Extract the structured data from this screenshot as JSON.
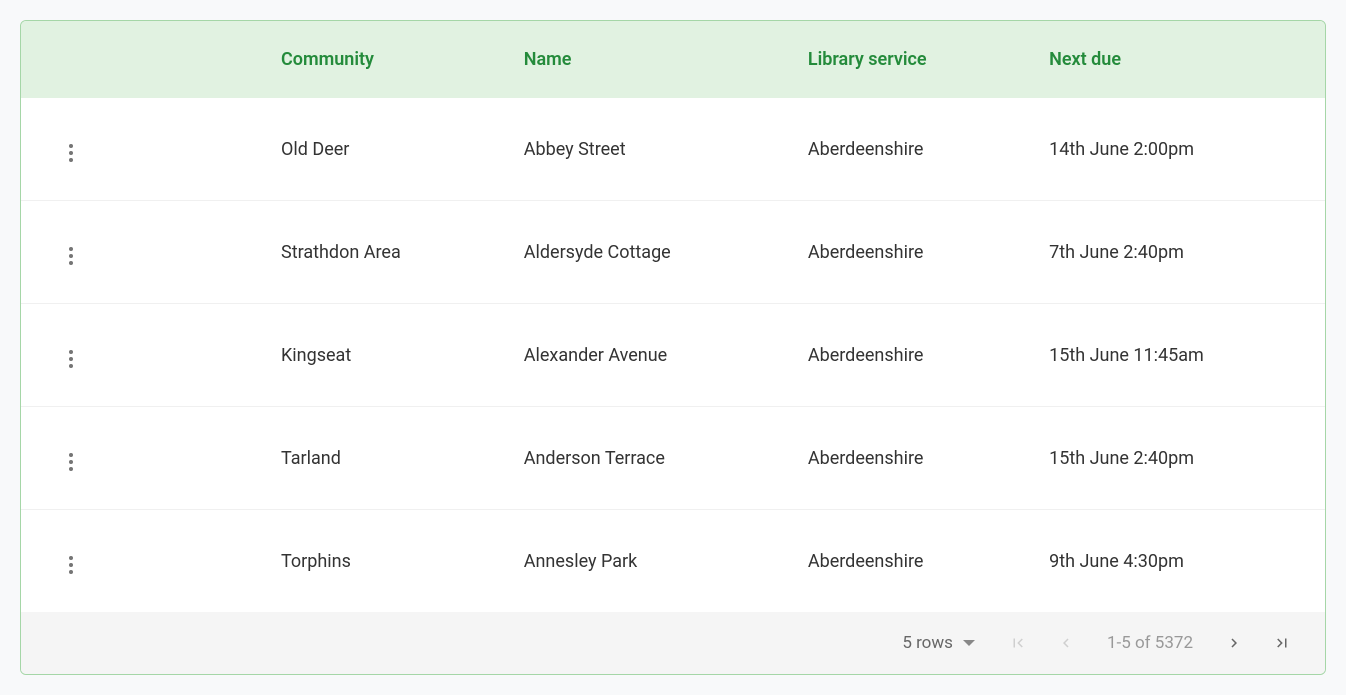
{
  "table": {
    "columns": {
      "community": "Community",
      "name": "Name",
      "service": "Library service",
      "due": "Next due"
    },
    "rows": [
      {
        "community": "Old Deer",
        "name": "Abbey Street",
        "service": "Aberdeenshire",
        "due": "14th June 2:00pm"
      },
      {
        "community": "Strathdon Area",
        "name": "Aldersyde Cottage",
        "service": "Aberdeenshire",
        "due": "7th June 2:40pm"
      },
      {
        "community": "Kingseat",
        "name": "Alexander Avenue",
        "service": "Aberdeenshire",
        "due": "15th June 11:45am"
      },
      {
        "community": "Tarland",
        "name": "Anderson Terrace",
        "service": "Aberdeenshire",
        "due": "15th June 2:40pm"
      },
      {
        "community": "Torphins",
        "name": "Annesley Park",
        "service": "Aberdeenshire",
        "due": "9th June 4:30pm"
      }
    ]
  },
  "footer": {
    "rows_label": "5 rows",
    "pagination": "1-5 of 5372"
  }
}
